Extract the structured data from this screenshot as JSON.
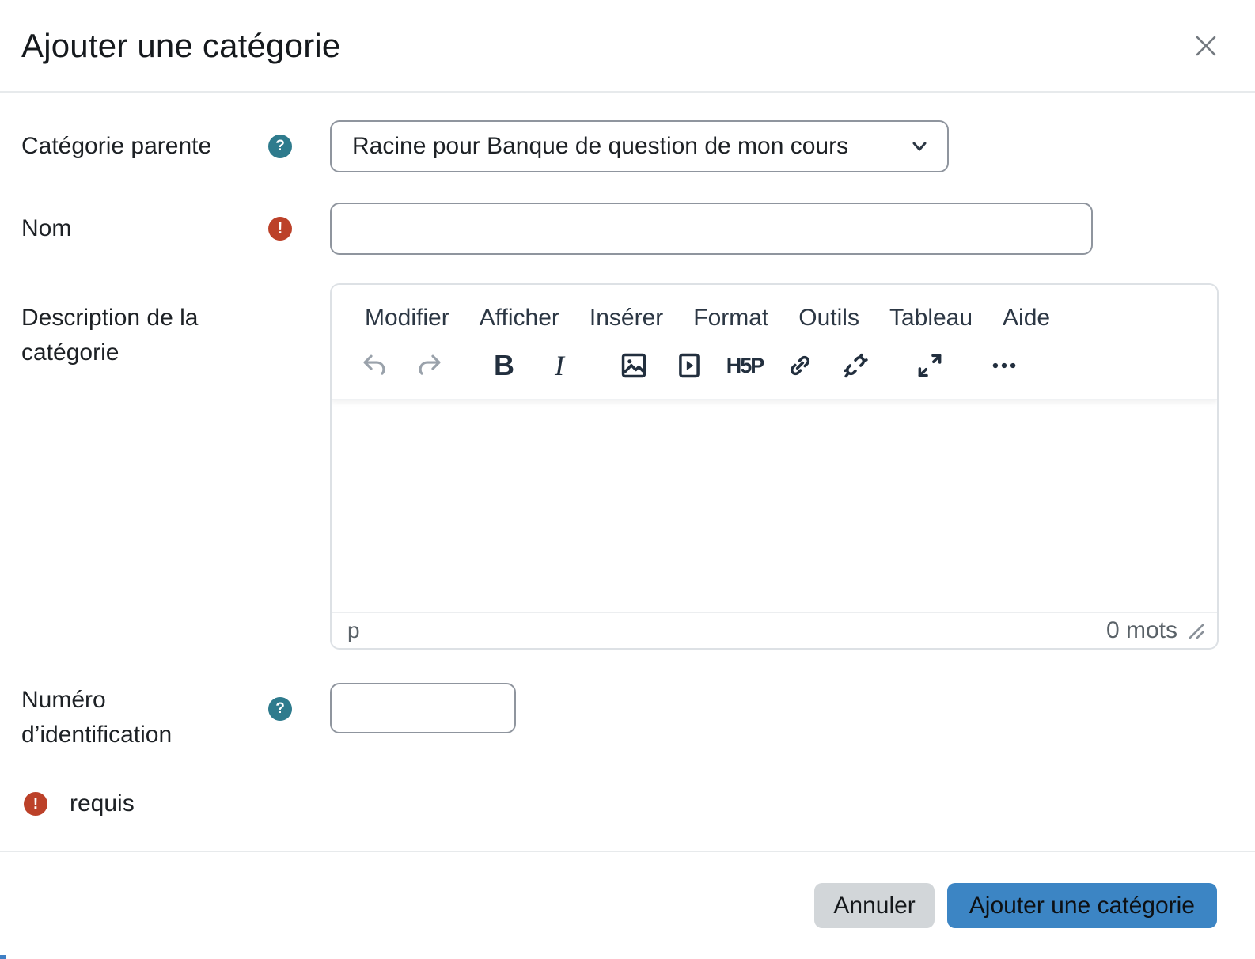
{
  "modal": {
    "title": "Ajouter une catégorie"
  },
  "form": {
    "parent_category": {
      "label": "Catégorie parente",
      "value": "Racine pour Banque de question de mon cours"
    },
    "name": {
      "label": "Nom",
      "value": ""
    },
    "description": {
      "label": "Description de la catégorie",
      "menu_items": [
        "Modifier",
        "Afficher",
        "Insérer",
        "Format",
        "Outils",
        "Tableau",
        "Aide"
      ],
      "toolbar": {
        "h5p_label": "H5P",
        "icon_names": [
          "undo",
          "redo",
          "bold",
          "italic",
          "image",
          "media",
          "h5p",
          "link",
          "unlink",
          "fullscreen",
          "more"
        ]
      },
      "status_bar": {
        "element_path": "p",
        "word_count": "0 mots"
      }
    },
    "idnumber": {
      "label": "Numéro d’identification",
      "value": ""
    },
    "required_note": {
      "label": "requis"
    }
  },
  "footer": {
    "cancel_label": "Annuler",
    "submit_label": "Ajouter une catégorie"
  },
  "colors": {
    "primary_button": "#3c85c4",
    "cancel_button": "#d2d6d9",
    "help_icon": "#2e7b8d",
    "required_icon": "#bc4129",
    "input_border": "#8f959e",
    "divider": "#e7eaec",
    "toolbar_icon": "#222f3e",
    "toolbar_icon_disabled": "#9aa2ab"
  }
}
